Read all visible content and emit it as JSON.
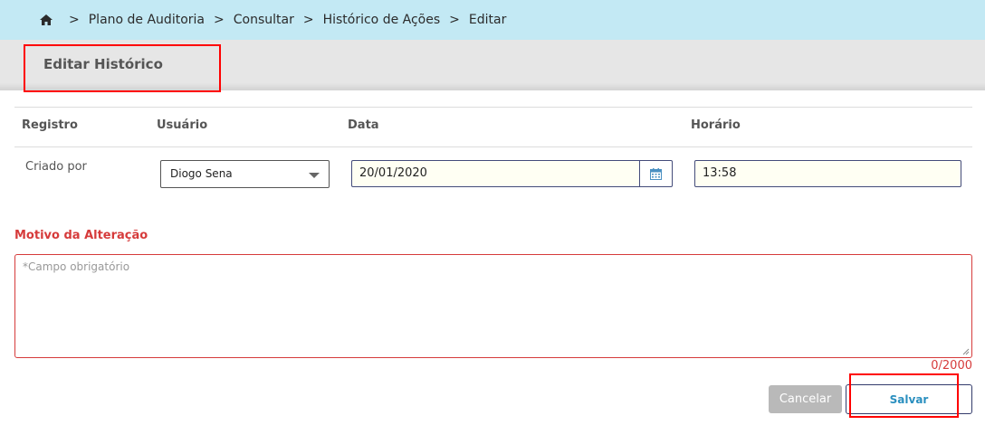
{
  "breadcrumb": {
    "home_icon": "home-icon",
    "items": [
      "Plano de Auditoria",
      "Consultar",
      "Histórico de Ações",
      "Editar"
    ],
    "separator": ">"
  },
  "page": {
    "title": "Editar Histórico"
  },
  "table": {
    "headers": {
      "registro": "Registro",
      "usuario": "Usuário",
      "data": "Data",
      "horario": "Horário"
    },
    "row": {
      "registro": "Criado por",
      "usuario": "Diogo Sena",
      "data": "20/01/2020",
      "horario": "13:58"
    }
  },
  "motivo": {
    "label": "Motivo da Alteração",
    "placeholder": "*Campo obrigatório",
    "counter": "0/2000"
  },
  "actions": {
    "cancel": "Cancelar",
    "save": "Salvar"
  },
  "colors": {
    "breadcrumb_bg": "#c3e9f4",
    "required": "#d63b3b",
    "save_text": "#2a8fbf",
    "annotation": "#ff0000"
  }
}
